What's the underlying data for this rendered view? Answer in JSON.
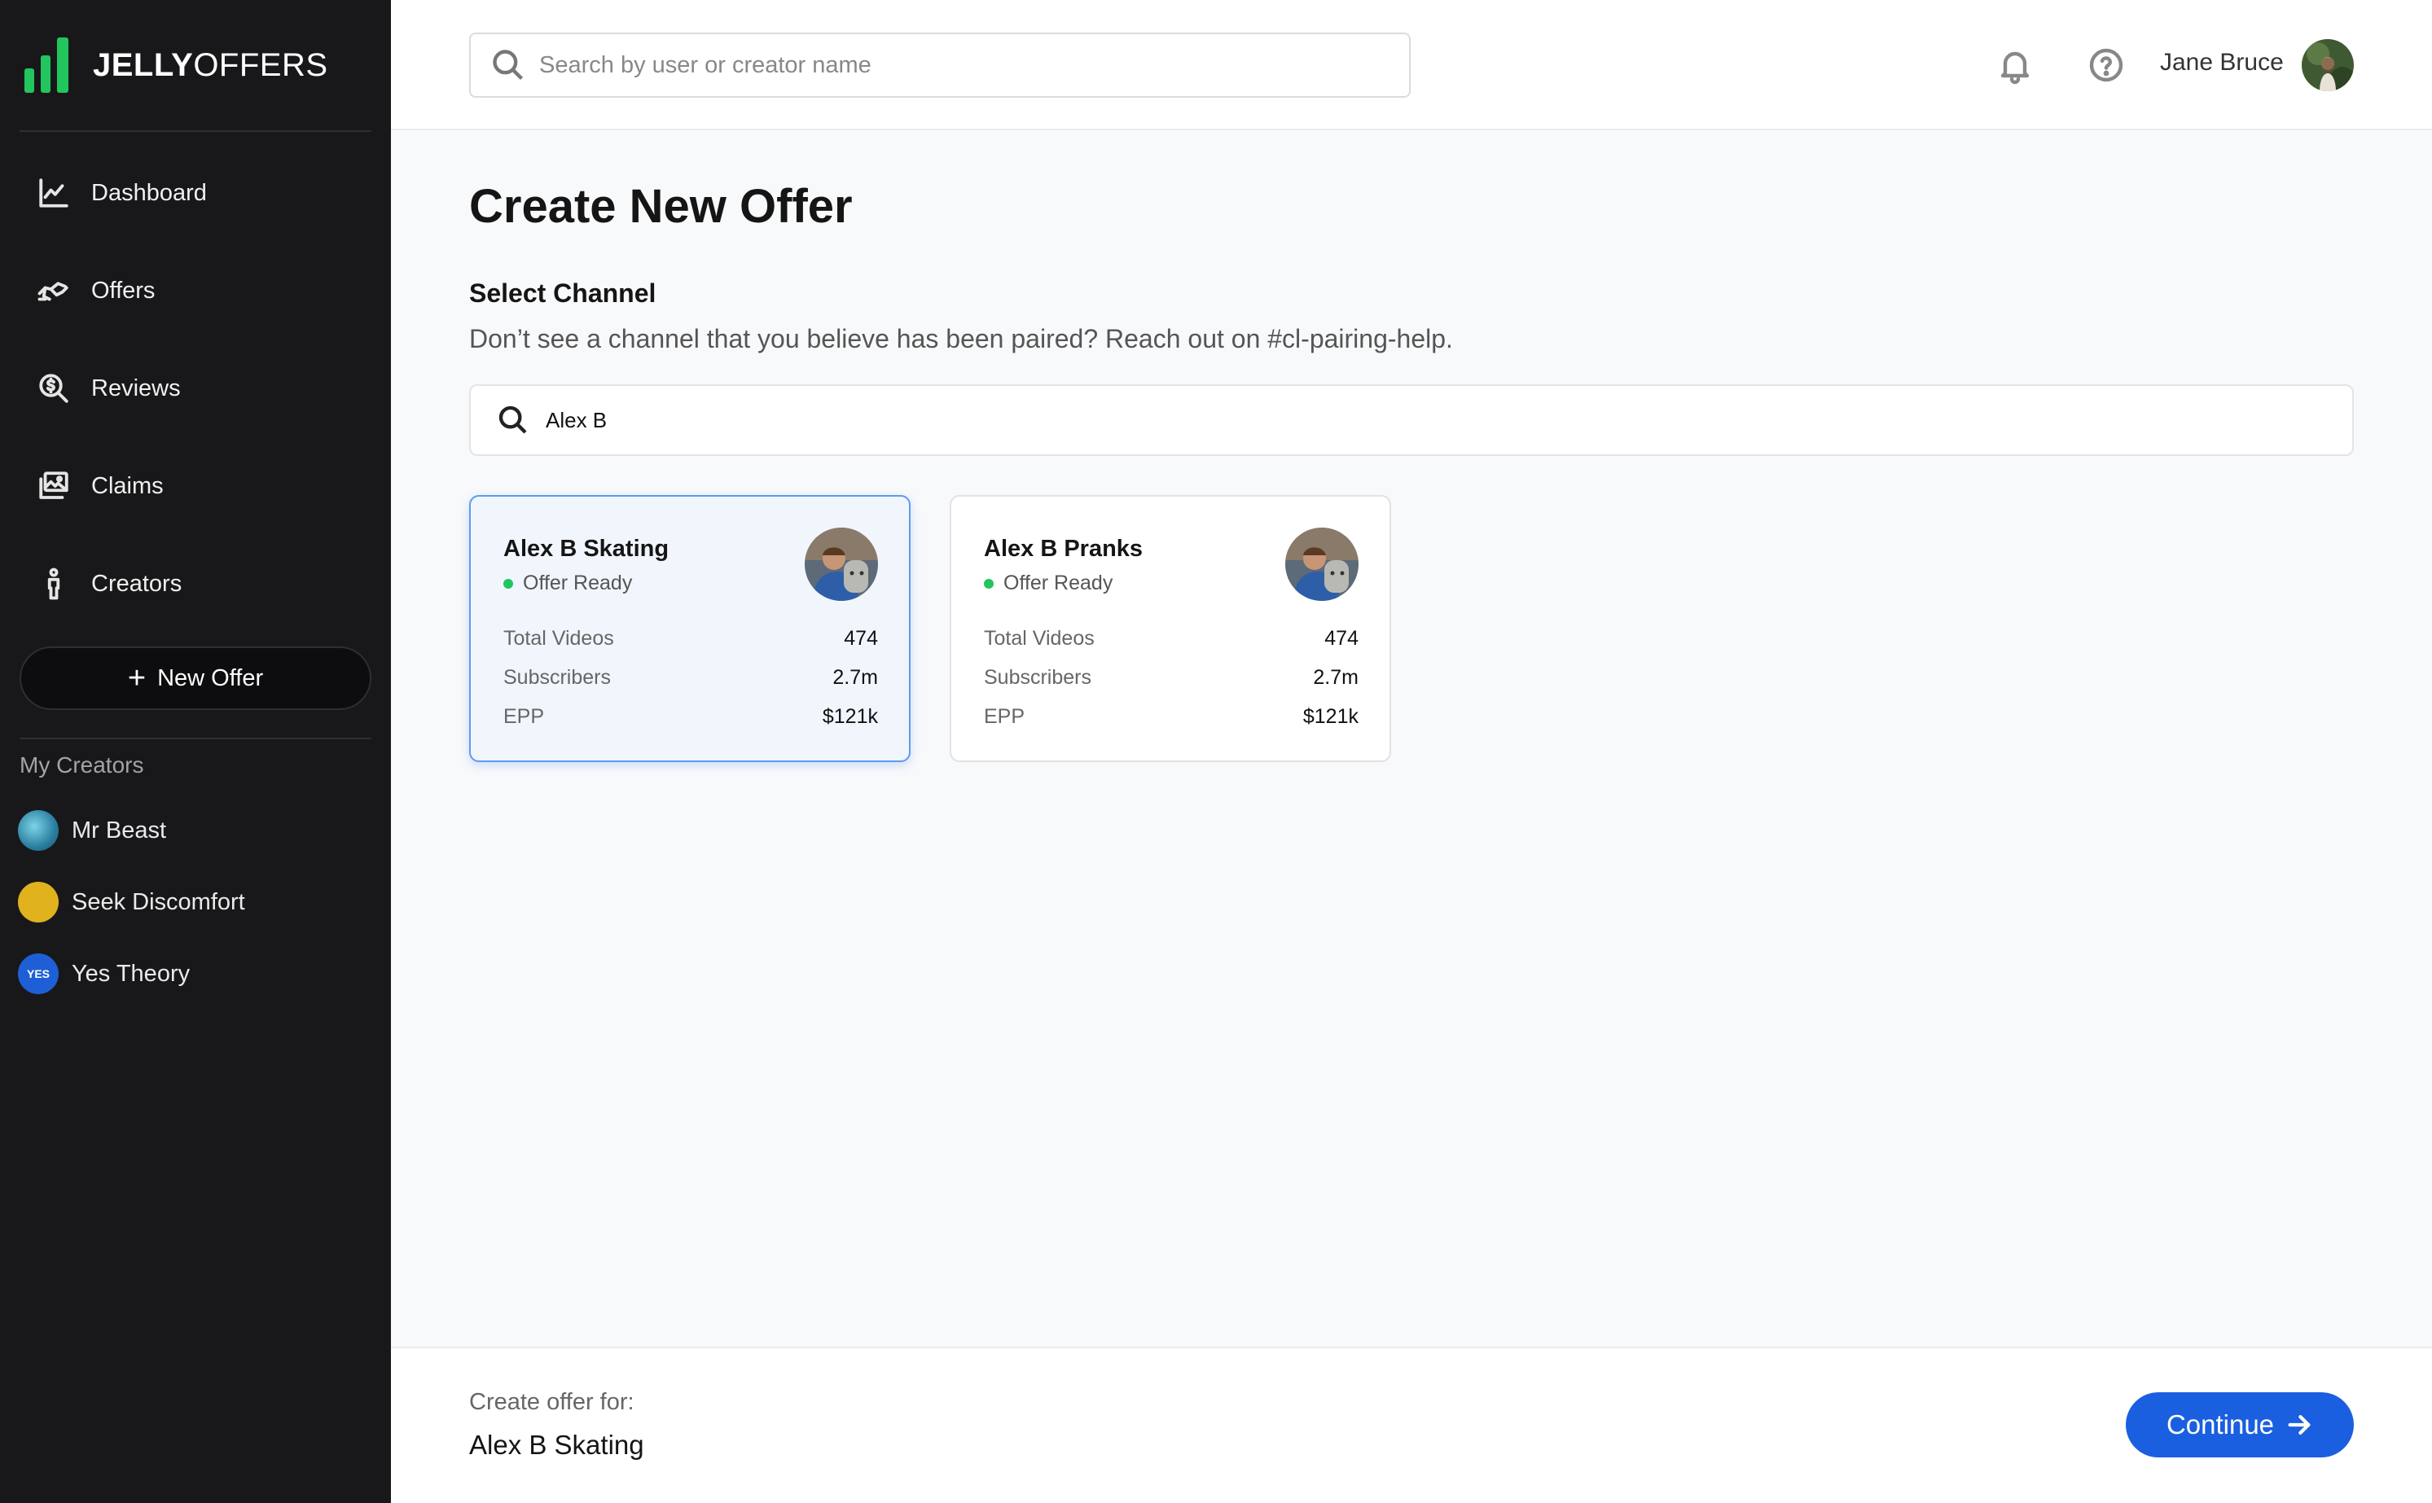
{
  "app": {
    "logo_bold": "JELLY",
    "logo_light": "OFFERS",
    "brand_color": "#22c55e",
    "accent_color": "#1a5fe0"
  },
  "sidebar": {
    "items": [
      {
        "label": "Dashboard",
        "icon": "chart-line-icon"
      },
      {
        "label": "Offers",
        "icon": "handshake-icon"
      },
      {
        "label": "Reviews",
        "icon": "dollar-search-icon"
      },
      {
        "label": "Claims",
        "icon": "images-icon"
      },
      {
        "label": "Creators",
        "icon": "person-icon"
      }
    ],
    "new_offer_label": "New Offer",
    "my_creators_label": "My Creators",
    "creators": [
      {
        "name": "Mr Beast",
        "icon": "mr-beast-avatar"
      },
      {
        "name": "Seek Discomfort",
        "icon": "seek-discomfort-avatar"
      },
      {
        "name": "Yes Theory",
        "icon": "yes-theory-avatar",
        "badge": "YES"
      }
    ]
  },
  "header": {
    "search_placeholder": "Search by user or creator name",
    "user_name": "Jane Bruce"
  },
  "main": {
    "title": "Create New Offer",
    "section_title": "Select Channel",
    "section_subtitle": "Don’t see a channel that you believe has been paired? Reach out on #cl-pairing-help.",
    "channel_search_value": "Alex B",
    "channels": [
      {
        "name": "Alex B Skating",
        "status": "Offer Ready",
        "selected": true,
        "stats": [
          {
            "label": "Total Videos",
            "value": "474"
          },
          {
            "label": "Subscribers",
            "value": "2.7m"
          },
          {
            "label": "EPP",
            "value": "$121k"
          }
        ]
      },
      {
        "name": "Alex B Pranks",
        "status": "Offer Ready",
        "selected": false,
        "stats": [
          {
            "label": "Total Videos",
            "value": "474"
          },
          {
            "label": "Subscribers",
            "value": "2.7m"
          },
          {
            "label": "EPP",
            "value": "$121k"
          }
        ]
      }
    ]
  },
  "footer": {
    "label": "Create offer for:",
    "selected_channel": "Alex B Skating",
    "continue_label": "Continue"
  }
}
